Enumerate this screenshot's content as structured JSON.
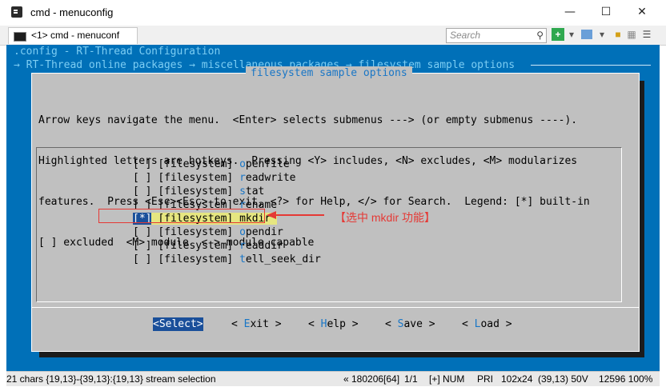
{
  "window": {
    "title": "cmd - menuconfig",
    "tab_label": "<1> cmd - menuconf",
    "search_placeholder": "Search"
  },
  "terminal": {
    "line1": ".config - RT-Thread Configuration",
    "line2": "→ RT-Thread online packages → miscellaneous packages → filesystem sample options"
  },
  "dialog": {
    "title": "filesystem sample options",
    "help_lines": [
      "Arrow keys navigate the menu.  <Enter> selects submenus ---> (or empty submenus ----).",
      "Highlighted letters are hotkeys.  Pressing <Y> includes, <N> excludes, <M> modularizes",
      "features.  Press <Esc><Esc> to exit, <?> for Help, </> for Search.  Legend: [*] built-in",
      "[ ] excluded  <M> module  < > module capable"
    ],
    "items": [
      {
        "check": " ",
        "prefix": "[filesystem] ",
        "hotkey": "o",
        "rest": "penfile"
      },
      {
        "check": " ",
        "prefix": "[filesystem] ",
        "hotkey": "r",
        "rest": "eadwrite"
      },
      {
        "check": " ",
        "prefix": "[filesystem] ",
        "hotkey": "s",
        "rest": "tat"
      },
      {
        "check": " ",
        "prefix": "[filesystem] ",
        "hotkey": "r",
        "rest": "ename"
      },
      {
        "check": "*",
        "prefix": "[filesystem] ",
        "hotkey": "m",
        "rest": "kdir"
      },
      {
        "check": " ",
        "prefix": "[filesystem] ",
        "hotkey": "o",
        "rest": "pendir"
      },
      {
        "check": " ",
        "prefix": "[filesystem] ",
        "hotkey": "r",
        "rest": "eaddir"
      },
      {
        "check": " ",
        "prefix": "[filesystem] ",
        "hotkey": "t",
        "rest": "ell_seek_dir"
      }
    ],
    "buttons": {
      "select": {
        "open": "<",
        "hotkey": "S",
        "rest": "elect",
        "close": ">"
      },
      "exit": {
        "open": "< ",
        "hotkey": "E",
        "rest": "xit",
        "close": " >"
      },
      "help": {
        "open": "< ",
        "hotkey": "H",
        "rest": "elp",
        "close": " >"
      },
      "save": {
        "open": "< ",
        "hotkey": "S",
        "rest": "ave",
        "close": " >"
      },
      "load": {
        "open": "< ",
        "hotkey": "L",
        "rest": "oad",
        "close": " >"
      }
    }
  },
  "annotation": {
    "text": "【选中 mkdir 功能】",
    "color": "#e53935"
  },
  "status_bar": {
    "selection": "21 chars {19,13}-{39,13}:{19,13} stream selection",
    "build": "« 180206[64]",
    "page": "1/1",
    "flags": "[+] NUM",
    "pri": "PRI",
    "size": "102x24",
    "pos": "(39,13) 50V",
    "zoom": "12596 100%"
  },
  "colors": {
    "terminal_bg": "#0070b8",
    "dialog_bg": "#c0c0c0",
    "hotkey": "#1976c6",
    "selection_bg": "#e6e680"
  }
}
